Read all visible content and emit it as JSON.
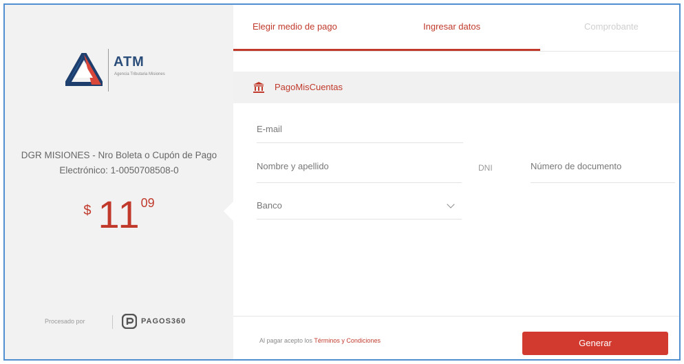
{
  "brand": {
    "name": "ATM",
    "subtitle": "Agencia Tributaria Misiones",
    "logo_icon": "atm-triangle-logo"
  },
  "payment": {
    "description": "DGR MISIONES - Nro Boleta o Cupón de Pago Electrónico: 1-0050708508-0",
    "currency": "$",
    "amount_integer": "11",
    "amount_decimal": "09"
  },
  "processed_by": {
    "label": "Procesado por",
    "brand": "PAGOS360",
    "icon": "pagos360-logo-icon"
  },
  "tabs": [
    {
      "label": "Elegir medio de pago",
      "state": "completed"
    },
    {
      "label": "Ingresar datos",
      "state": "active"
    },
    {
      "label": "Comprobante",
      "state": "disabled"
    }
  ],
  "method": {
    "label": "PagoMisCuentas",
    "icon": "bank-icon"
  },
  "form": {
    "email_placeholder": "E-mail",
    "name_placeholder": "Nombre y apellido",
    "doc_type": "DNI",
    "doc_placeholder": "Número de documento",
    "bank_placeholder": "Banco"
  },
  "footer": {
    "terms_prefix": "Al pagar acepto los",
    "terms_link": "Términos y Condiciones",
    "submit_label": "Generar"
  },
  "colors": {
    "accent": "#c0392b",
    "button": "#d23a2f",
    "panel": "#f2f2f2",
    "frame": "#4f8fd0"
  }
}
